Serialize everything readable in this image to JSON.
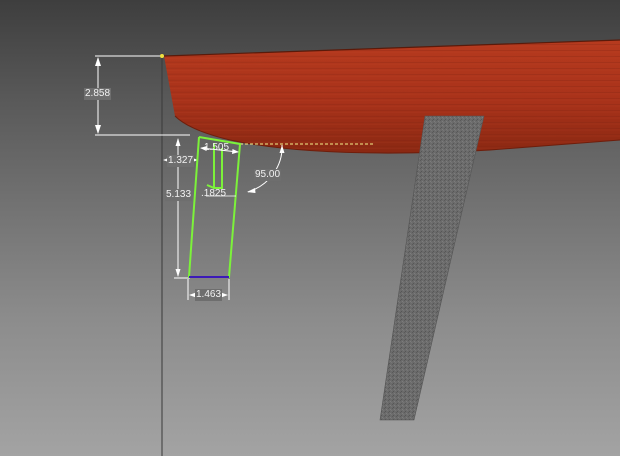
{
  "dimensions": {
    "seat_thickness": "2.858",
    "leg_top_offset": "1.327",
    "leg_top_width": "1.505",
    "leg_height": "5.133",
    "tenon_depth": ".1825",
    "leg_angle": "95.00",
    "leg_bottom_width": "1.463"
  },
  "colors": {
    "background_top": "#3e3e3e",
    "background_bottom": "#a3a3a3",
    "seat_wood": "#a8321a",
    "seat_wood_dark": "#7d2210",
    "leg_gray": "#6a6a6a",
    "sketch_profile": "#7cf23a",
    "sketch_bottom_edge": "#3c1ab8",
    "dimension_lines": "#ffffff",
    "construction_line": "#f5f08a",
    "anchor_point": "#f0e040"
  }
}
